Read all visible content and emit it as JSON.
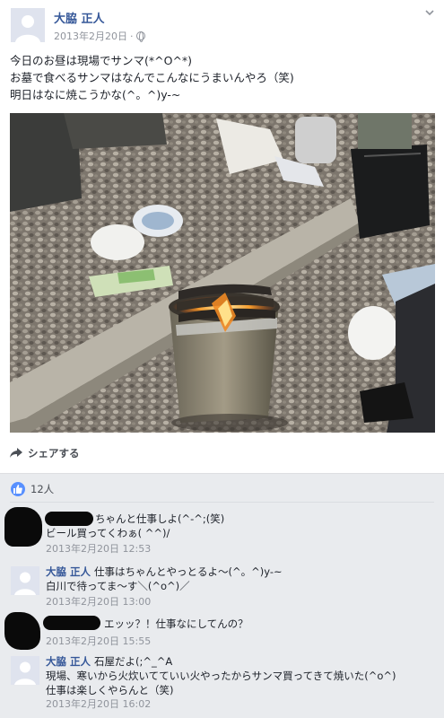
{
  "post": {
    "author": "大脇 正人",
    "timestamp": "2013年2月20日",
    "dot": "·",
    "lines": [
      "今日のお昼は現場でサンマ(*^O^*)",
      "お墓で食べるサンマはなんでこんなにうまいんやろ（笑)",
      "明日はなに焼こうかな(^。^)y-~"
    ],
    "icons": {
      "privacy": "globe-icon",
      "menu": "chevron-down-icon"
    }
  },
  "actions": {
    "share_label": "シェアする",
    "share_icon": "share-arrow-icon"
  },
  "reactions": {
    "like_count": "12人",
    "icon": "thumbs-up-icon",
    "color": "#5890ff"
  },
  "comments": [
    {
      "author": "",
      "line1": "ちゃんと仕事しよ(^-^;(笑)",
      "line2": "ビール買ってくわぁ( ^^)/",
      "time": "2013年2月20日 12:53"
    },
    {
      "author": "大脇 正人",
      "line1": "仕事はちゃんとやっとるよ〜(^。^)y-~",
      "line2": "白川で待ってま〜す＼(^o^)／",
      "time": "2013年2月20日 13:00"
    },
    {
      "author": "",
      "line1": "エッッ？！仕事なにしてんの？",
      "time": "2013年2月20日 15:55"
    },
    {
      "author": "大脇 正人",
      "line1": "石屋だよ(;^_^A",
      "line2": "現場、寒いから火炊いてていい火やったからサンマ買ってきて焼いた(^o^)",
      "line3": "仕事は楽しくやらんと（笑)",
      "time": "2013年2月20日 16:02"
    }
  ],
  "colors": {
    "link": "#365899",
    "muted": "#90949c",
    "background": "#e9ebee"
  }
}
